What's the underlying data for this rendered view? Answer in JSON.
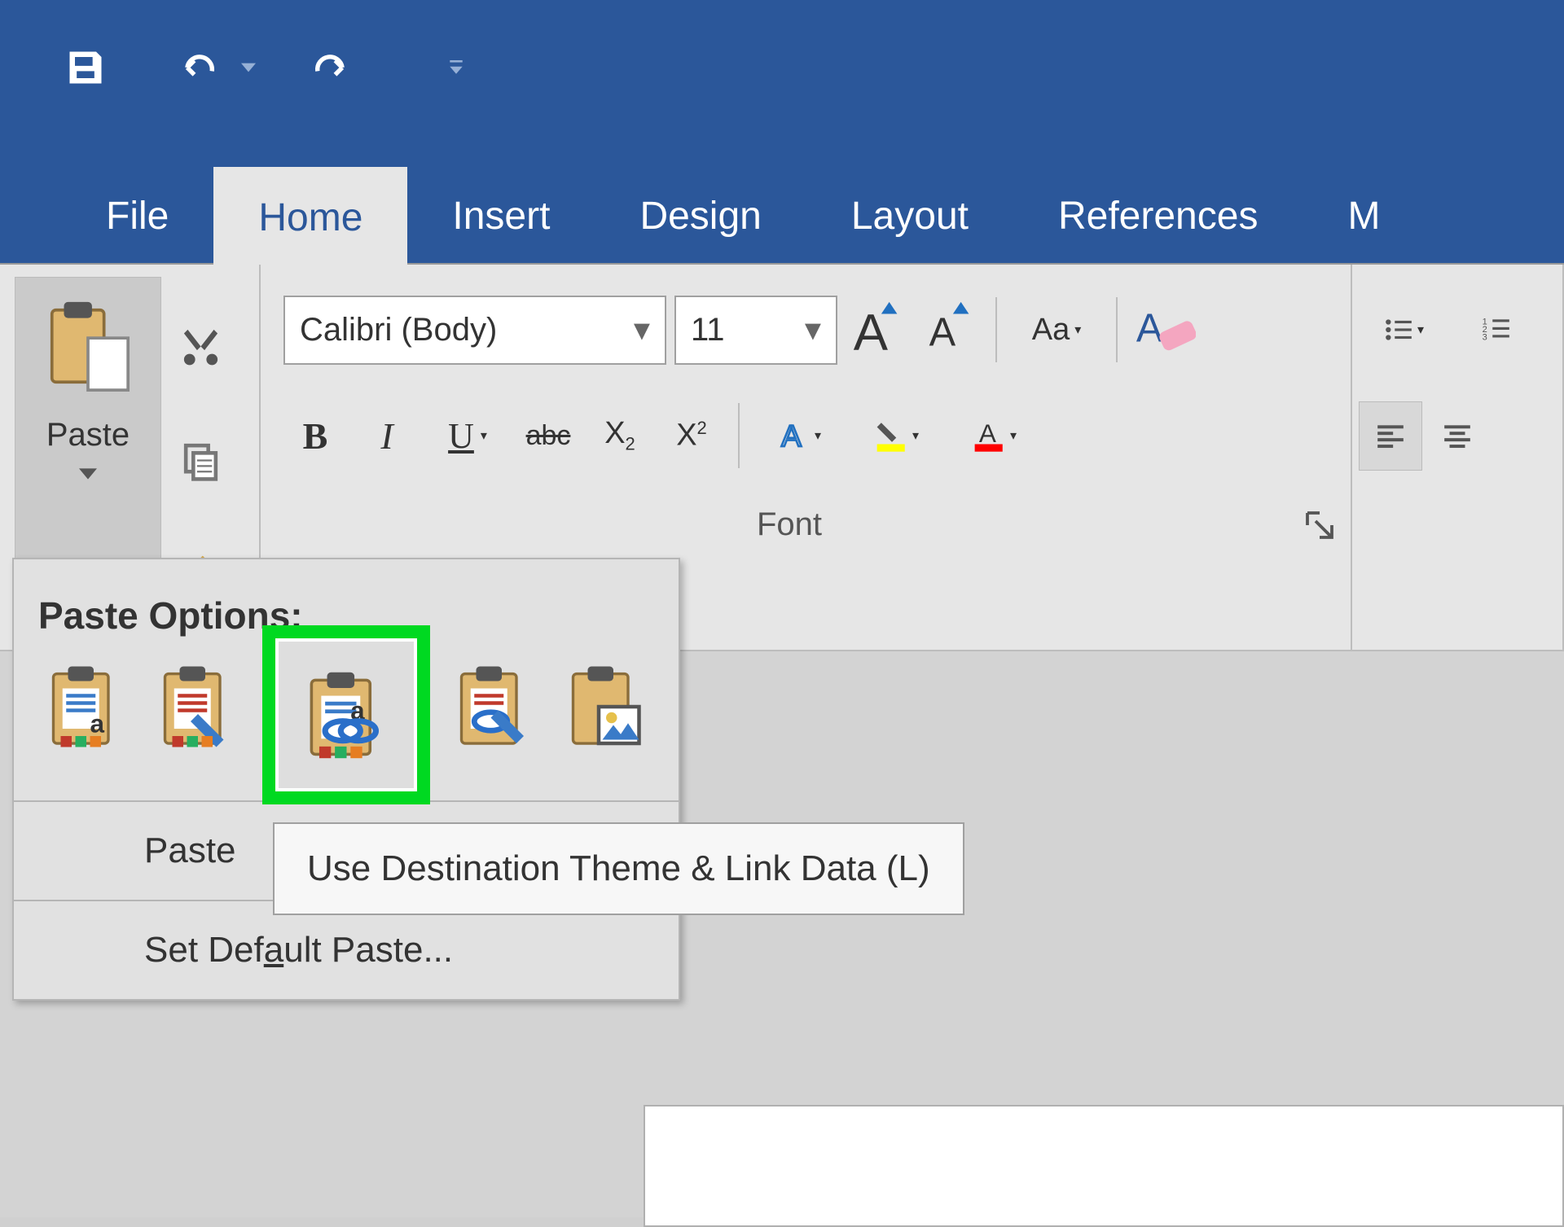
{
  "quick_access": {
    "save": "save",
    "undo": "undo",
    "redo": "redo",
    "customize": "customize"
  },
  "tabs": [
    "File",
    "Home",
    "Insert",
    "Design",
    "Layout",
    "References",
    "M"
  ],
  "active_tab_index": 1,
  "ribbon": {
    "clipboard": {
      "paste_label": "Paste",
      "cut": "Cut",
      "copy": "Copy",
      "format_painter": "Format Painter"
    },
    "font": {
      "name": "Calibri (Body)",
      "size": "11",
      "group_label": "Font"
    }
  },
  "paste_popup": {
    "header": "Paste Options:",
    "paste_special": "Paste",
    "set_default": "Set Default Paste..."
  },
  "tooltip": "Use Destination Theme & Link Data (L)"
}
